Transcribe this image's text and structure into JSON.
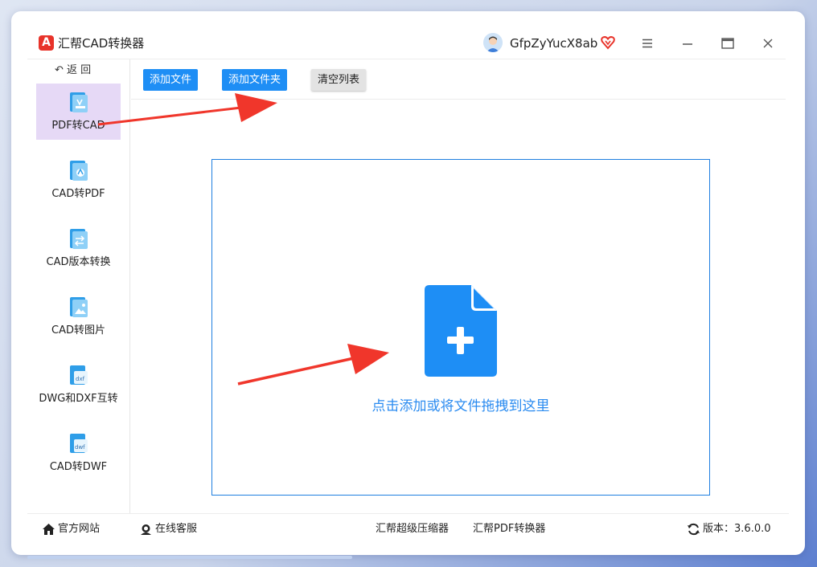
{
  "app": {
    "title": "汇帮CAD转换器",
    "logo_letter": "A"
  },
  "user": {
    "name": "GfpZyYucX8ab"
  },
  "window_controls": [
    "menu-icon",
    "minimize-icon",
    "maximize-icon",
    "close-icon"
  ],
  "sidebar": {
    "back_label": "返 回",
    "items": [
      {
        "label": "PDF转CAD",
        "icon": "pdf-to-cad-icon",
        "active": true
      },
      {
        "label": "CAD转PDF",
        "icon": "cad-to-pdf-icon",
        "active": false
      },
      {
        "label": "CAD版本转换",
        "icon": "cad-version-icon",
        "active": false
      },
      {
        "label": "CAD转图片",
        "icon": "cad-to-image-icon",
        "active": false
      },
      {
        "label": "DWG和DXF互转",
        "icon": "dwg-dxf-icon",
        "active": false
      },
      {
        "label": "CAD转DWF",
        "icon": "cad-to-dwf-icon",
        "active": false
      }
    ]
  },
  "toolbar": {
    "add_file": "添加文件",
    "add_folder": "添加文件夹",
    "clear_list": "清空列表"
  },
  "dropzone": {
    "text": "点击添加或将文件拖拽到这里"
  },
  "statusbar": {
    "website": "官方网站",
    "support": "在线客服",
    "compressor": "汇帮超级压缩器",
    "pdf_converter": "汇帮PDF转换器",
    "version_label": "版本：",
    "version": "3.6.0.0"
  },
  "colors": {
    "accent": "#1e8ef5",
    "active_nav": "#e6d9f6",
    "arrow": "#f0362b",
    "logo": "#e8332a"
  }
}
